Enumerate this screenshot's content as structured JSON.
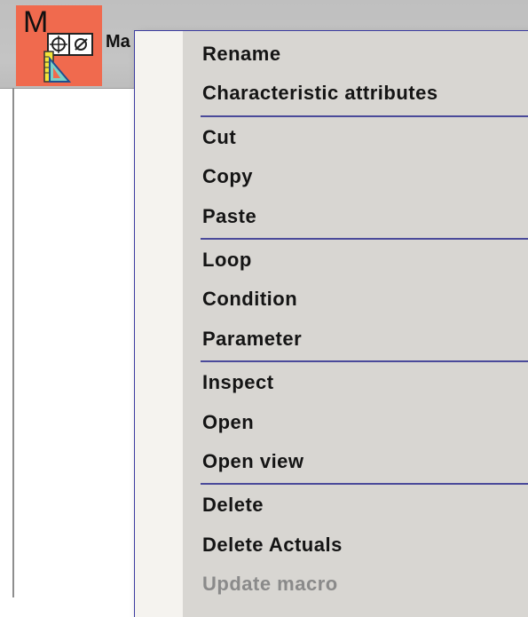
{
  "node": {
    "letter": "M",
    "label": "Ma",
    "icon": "macro-diagram-icon",
    "background_color": "#f06a4e"
  },
  "context_menu": {
    "groups": [
      [
        {
          "label": "Rename",
          "enabled": true
        },
        {
          "label": "Characteristic attributes",
          "enabled": true
        }
      ],
      [
        {
          "label": "Cut",
          "enabled": true
        },
        {
          "label": "Copy",
          "enabled": true
        },
        {
          "label": "Paste",
          "enabled": true
        }
      ],
      [
        {
          "label": "Loop",
          "enabled": true
        },
        {
          "label": "Condition",
          "enabled": true
        },
        {
          "label": "Parameter",
          "enabled": true
        }
      ],
      [
        {
          "label": "Inspect",
          "enabled": true
        },
        {
          "label": "Open",
          "enabled": true
        },
        {
          "label": "Open view",
          "enabled": true
        }
      ],
      [
        {
          "label": "Delete",
          "enabled": true
        },
        {
          "label": "Delete Actuals",
          "enabled": true
        },
        {
          "label": "Update macro",
          "enabled": false
        }
      ]
    ],
    "separator_color": "#4a4a9a"
  }
}
